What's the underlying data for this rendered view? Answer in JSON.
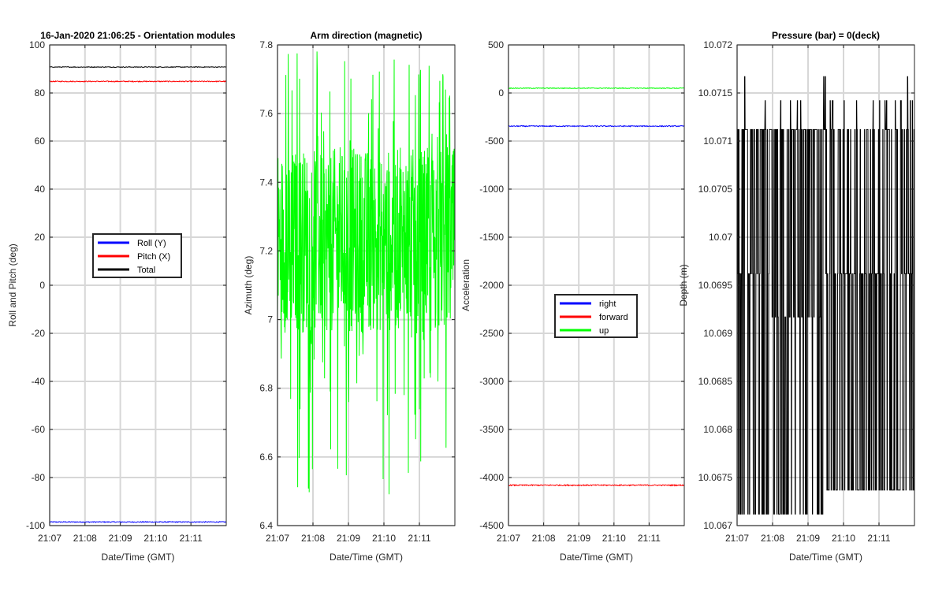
{
  "chart_data": [
    {
      "type": "line",
      "title": "16-Jan-2020 21:06:25 - Orientation modules",
      "xlabel": "Date/Time (GMT)",
      "ylabel": "Roll and Pitch (deg)",
      "x_ticks": [
        "21:07",
        "21:08",
        "21:09",
        "21:10",
        "21:11"
      ],
      "xlim": [
        "21:07:00",
        "21:12:00"
      ],
      "ylim": [
        -100,
        100
      ],
      "y_ticks": [
        -100,
        -80,
        -60,
        -40,
        -20,
        0,
        20,
        40,
        60,
        80,
        100
      ],
      "y_tick_labels": [
        "-100",
        "-80",
        "-60",
        "-40",
        "-20",
        "0",
        "20",
        "40",
        "60",
        "80",
        "100"
      ],
      "grid": true,
      "legend": "center",
      "series": [
        {
          "name": "Roll (Y)",
          "color": "#0000ff",
          "mean": -98.5,
          "noise": 0.2
        },
        {
          "name": "Pitch (X)",
          "color": "#ff0000",
          "mean": 84.8,
          "noise": 0.2
        },
        {
          "name": "Total",
          "color": "#000000",
          "mean": 90.8,
          "noise": 0.15
        }
      ]
    },
    {
      "type": "line",
      "title": "Arm direction (magnetic)",
      "xlabel": "Date/Time (GMT)",
      "ylabel": "Azimuth (deg)",
      "x_ticks": [
        "21:07",
        "21:08",
        "21:09",
        "21:10",
        "21:11"
      ],
      "xlim": [
        "21:07:00",
        "21:12:00"
      ],
      "ylim": [
        6.4,
        7.8
      ],
      "y_ticks": [
        6.4,
        6.6,
        6.8,
        7,
        7.2,
        7.4,
        7.6,
        7.8
      ],
      "y_tick_labels": [
        "6.4",
        "6.6",
        "6.8",
        "7",
        "7.2",
        "7.4",
        "7.6",
        "7.8"
      ],
      "grid": true,
      "series": [
        {
          "name": "azimuth",
          "color": "#00ff00",
          "mean": 7.2,
          "low": 6.96,
          "high": 7.5,
          "min": 6.48,
          "max": 7.79
        }
      ]
    },
    {
      "type": "line",
      "title": "",
      "xlabel": "Date/Time (GMT)",
      "ylabel": "Acceleration",
      "x_ticks": [
        "21:07",
        "21:08",
        "21:09",
        "21:10",
        "21:11"
      ],
      "xlim": [
        "21:07:00",
        "21:12:00"
      ],
      "ylim": [
        -4500,
        500
      ],
      "y_ticks": [
        -4500,
        -4000,
        -3500,
        -3000,
        -2500,
        -2000,
        -1500,
        -1000,
        -500,
        0,
        500
      ],
      "y_tick_labels": [
        "-4500",
        "-4000",
        "-3500",
        "-3000",
        "-2500",
        "-2000",
        "-1500",
        "-1000",
        "-500",
        "0",
        "500"
      ],
      "grid": true,
      "legend": "center",
      "series": [
        {
          "name": "right",
          "color": "#0000ff",
          "mean": -345,
          "noise": 5
        },
        {
          "name": "forward",
          "color": "#ff0000",
          "mean": -4080,
          "noise": 6
        },
        {
          "name": "up",
          "color": "#00ff00",
          "mean": 50,
          "noise": 4
        }
      ]
    },
    {
      "type": "line",
      "title": "Pressure (bar) = 0(deck)",
      "xlabel": "Date/Time (GMT)",
      "ylabel": "Depth (m)",
      "x_ticks": [
        "21:07",
        "21:08",
        "21:09",
        "21:10",
        "21:11"
      ],
      "xlim": [
        "21:07:00",
        "21:12:00"
      ],
      "ylim": [
        10.067,
        10.072
      ],
      "y_ticks": [
        10.067,
        10.0675,
        10.068,
        10.0685,
        10.069,
        10.0695,
        10.07,
        10.0705,
        10.071,
        10.0715,
        10.072
      ],
      "y_tick_labels": [
        "10.067",
        "10.0675",
        "10.068",
        "10.0685",
        "10.069",
        "10.0695",
        "10.07",
        "10.0705",
        "10.071",
        "10.0715",
        "10.072"
      ],
      "grid": true,
      "series": [
        {
          "name": "depth",
          "color": "#000000",
          "levels": [
            10.06712,
            10.06737,
            10.06962,
            10.06917,
            10.07112,
            10.07142
          ],
          "min": 10.06712,
          "max": 10.07167
        }
      ]
    }
  ]
}
